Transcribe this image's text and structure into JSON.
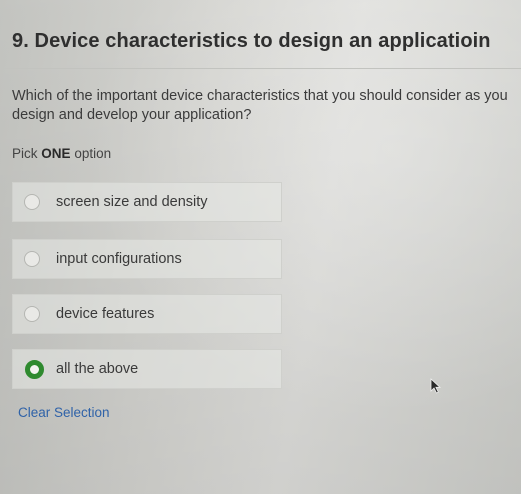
{
  "question": {
    "title": "9. Device characteristics to design an applicatioin",
    "text": "Which of the  important device characteristics that you should consider as you design and develop your application?",
    "pick_prefix": "Pick",
    "pick_bold": "ONE",
    "pick_suffix": "option"
  },
  "options": [
    {
      "label": "screen size and density",
      "selected": false
    },
    {
      "label": "input configurations",
      "selected": false
    },
    {
      "label": "device features",
      "selected": false
    },
    {
      "label": "all the above",
      "selected": true
    }
  ],
  "clear_selection_label": "Clear Selection",
  "colors": {
    "selected_radio": "#2f8a2f",
    "link": "#2f62a8"
  },
  "icons": {
    "cursor": "mouse-pointer-icon"
  }
}
